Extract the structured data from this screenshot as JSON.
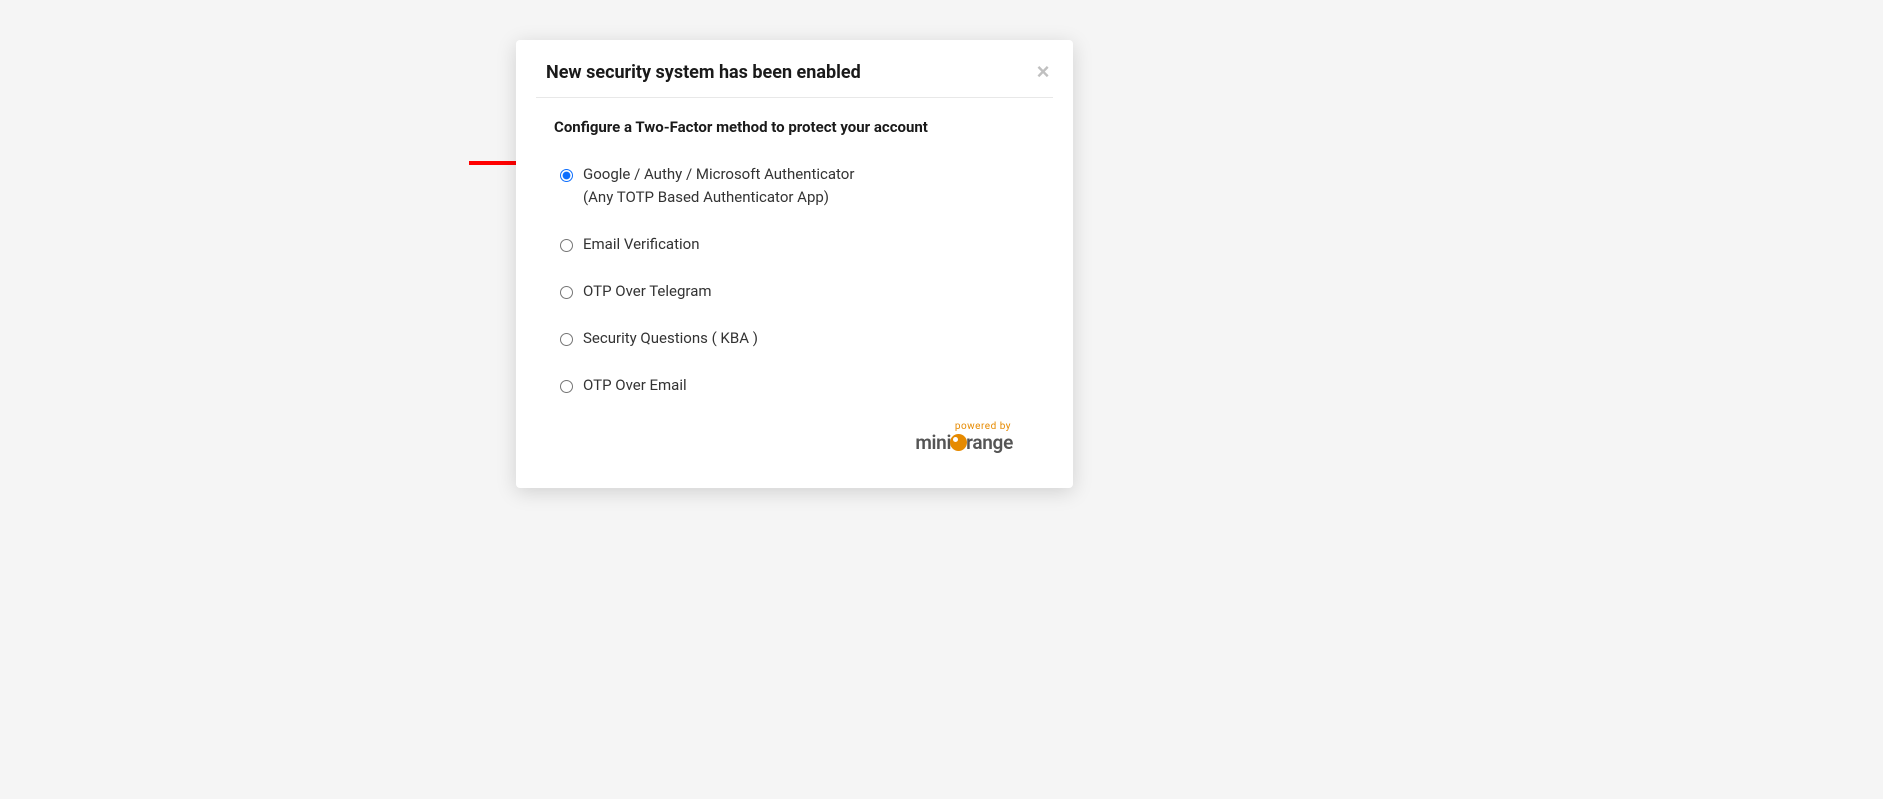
{
  "modal": {
    "title": "New security system has been enabled",
    "subtitle": "Configure a Two-Factor method to protect your account",
    "options": [
      {
        "label": "Google / Authy / Microsoft Authenticator",
        "sublabel": "(Any TOTP Based Authenticator App)",
        "checked": true
      },
      {
        "label": "Email Verification",
        "sublabel": "",
        "checked": false
      },
      {
        "label": "OTP Over Telegram",
        "sublabel": "",
        "checked": false
      },
      {
        "label": "Security Questions ( KBA )",
        "sublabel": "",
        "checked": false
      },
      {
        "label": "OTP Over Email",
        "sublabel": "",
        "checked": false
      }
    ],
    "footer": {
      "powered_by": "powered by",
      "brand_prefix": "mini",
      "brand_suffix": "range"
    }
  },
  "colors": {
    "accent": "#0d6efd",
    "brand_orange": "#e68a00"
  }
}
